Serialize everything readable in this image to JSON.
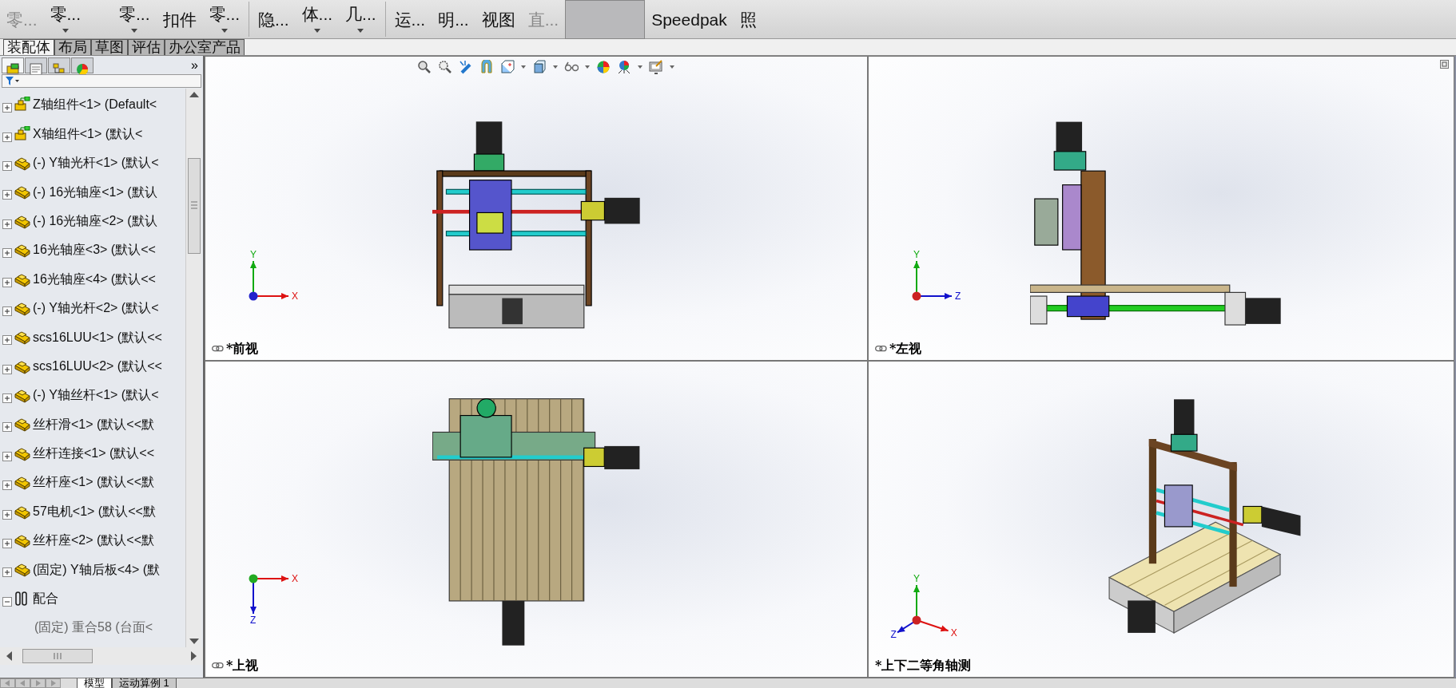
{
  "toolbar": [
    {
      "label": "零...",
      "dropdown": false,
      "disabled": true
    },
    {
      "label": "零...",
      "dropdown": true,
      "disabled": false
    },
    {
      "label": "零...",
      "dropdown": true,
      "disabled": false
    },
    {
      "label": "扣件",
      "dropdown": false,
      "disabled": false
    },
    {
      "label": "零...",
      "dropdown": true,
      "disabled": false
    },
    {
      "label": "隐...",
      "dropdown": false,
      "disabled": false
    },
    {
      "label": "体...",
      "dropdown": true,
      "disabled": false
    },
    {
      "label": "几...",
      "dropdown": true,
      "disabled": false
    },
    {
      "label": "运...",
      "dropdown": false,
      "disabled": false
    },
    {
      "label": "明...",
      "dropdown": false,
      "disabled": false
    },
    {
      "label": "视图",
      "dropdown": false,
      "disabled": false
    },
    {
      "label": "直...",
      "dropdown": false,
      "disabled": true
    },
    {
      "label": "Speedpak",
      "dropdown": false,
      "disabled": false
    },
    {
      "label": "照",
      "dropdown": false,
      "disabled": false
    }
  ],
  "tabs": [
    {
      "label": "装配体",
      "selected": true
    },
    {
      "label": "布局",
      "selected": false
    },
    {
      "label": "草图",
      "selected": false
    },
    {
      "label": "评估",
      "selected": false
    },
    {
      "label": "办公室产品",
      "selected": false
    }
  ],
  "panel_tabs": [
    {
      "selected": true
    },
    {
      "selected": false
    },
    {
      "selected": false
    },
    {
      "selected": false
    }
  ],
  "panel_more": "»",
  "tree": [
    {
      "label": "Z轴组件<1> (Default<",
      "kind": "assembly",
      "expanded": false
    },
    {
      "label": "X轴组件<1> (默认<",
      "kind": "assembly",
      "expanded": false
    },
    {
      "label": "(-) Y轴光杆<1> (默认<",
      "kind": "part",
      "expanded": false
    },
    {
      "label": "(-) 16光轴座<1> (默认",
      "kind": "part",
      "expanded": false
    },
    {
      "label": "(-) 16光轴座<2> (默认",
      "kind": "part",
      "expanded": false
    },
    {
      "label": "16光轴座<3> (默认<<",
      "kind": "part",
      "expanded": false
    },
    {
      "label": "16光轴座<4> (默认<<",
      "kind": "part",
      "expanded": false
    },
    {
      "label": "(-) Y轴光杆<2> (默认<",
      "kind": "part",
      "expanded": false
    },
    {
      "label": "scs16LUU<1> (默认<<",
      "kind": "part",
      "expanded": false
    },
    {
      "label": "scs16LUU<2> (默认<<",
      "kind": "part",
      "expanded": false
    },
    {
      "label": "(-) Y轴丝杆<1> (默认<",
      "kind": "part",
      "expanded": false
    },
    {
      "label": "丝杆滑<1> (默认<<默",
      "kind": "part",
      "expanded": false
    },
    {
      "label": "丝杆连接<1> (默认<<",
      "kind": "part",
      "expanded": false
    },
    {
      "label": "丝杆座<1> (默认<<默",
      "kind": "part",
      "expanded": false
    },
    {
      "label": "57电机<1> (默认<<默",
      "kind": "part",
      "expanded": false
    },
    {
      "label": "丝杆座<2> (默认<<默",
      "kind": "part",
      "expanded": false
    },
    {
      "label": "(固定) Y轴后板<4> (默",
      "kind": "part",
      "expanded": false
    },
    {
      "label": "配合",
      "kind": "mates",
      "expanded": true,
      "children": [
        {
          "label": "(固定) 重合58 (台面<"
        }
      ]
    }
  ],
  "viewports": [
    {
      "label": "*前视",
      "kind": "front",
      "linked": true,
      "axes": {
        "x": "X",
        "y": "Y"
      }
    },
    {
      "label": "*左视",
      "kind": "left",
      "linked": true,
      "axes": {
        "y": "Y",
        "z": "Z"
      }
    },
    {
      "label": "*上视",
      "kind": "top",
      "linked": true,
      "axes": {
        "x": "X",
        "z": "Z"
      }
    },
    {
      "label": "*上下二等角轴测",
      "kind": "iso",
      "linked": false,
      "axes": {
        "x": "X",
        "y": "Y",
        "z": "Z"
      }
    }
  ],
  "bottom_tabs": [
    {
      "label": "模型",
      "selected": true
    },
    {
      "label": "运动算例 1",
      "selected": false
    }
  ]
}
